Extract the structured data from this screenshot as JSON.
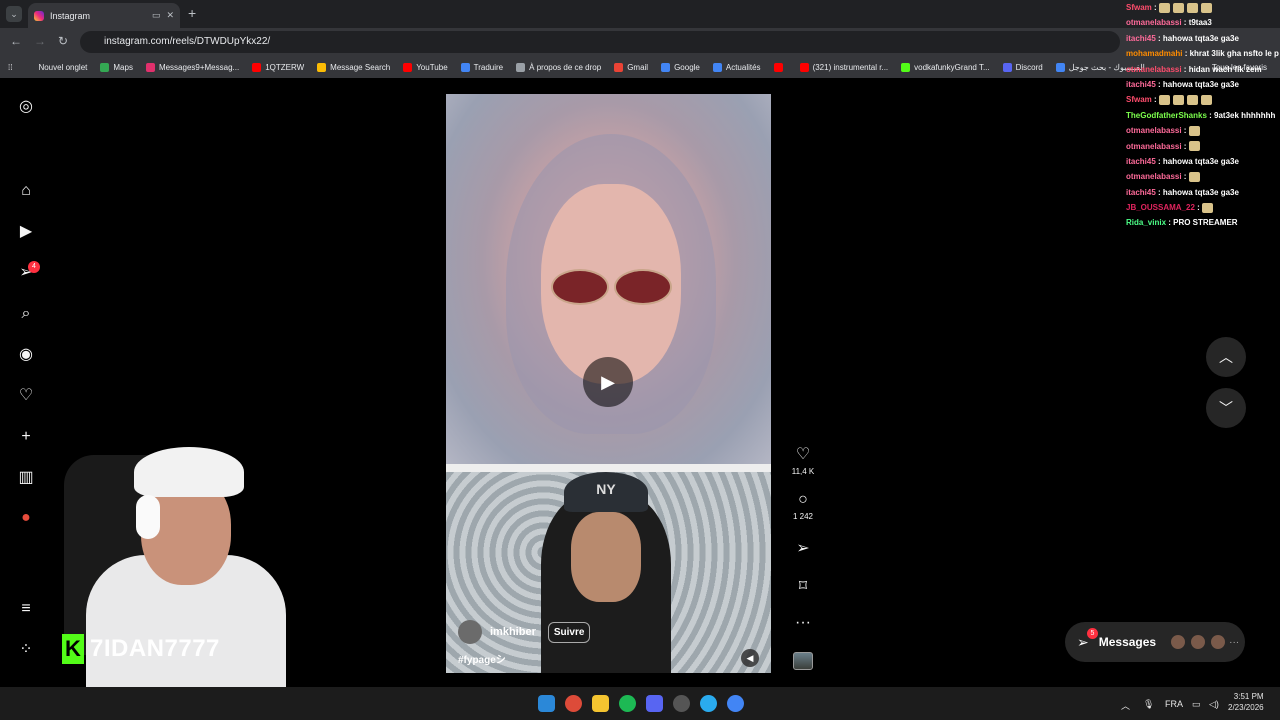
{
  "browser": {
    "tab_title": "Instagram",
    "url": "instagram.com/reels/DTWDUpYkx22/",
    "bookmarks": [
      {
        "label": "Nouvel onglet",
        "color": "#35363a"
      },
      {
        "label": "Maps",
        "color": "#34a853"
      },
      {
        "label": "Messages9+Messag...",
        "color": "#e1306c"
      },
      {
        "label": "1QTZERW",
        "color": "#ff0000"
      },
      {
        "label": "Message Search",
        "color": "#fbbc05"
      },
      {
        "label": "YouTube",
        "color": "#ff0000"
      },
      {
        "label": "Traduire",
        "color": "#4285f4"
      },
      {
        "label": "À propos de ce drop",
        "color": "#9aa0a6"
      },
      {
        "label": "Gmail",
        "color": "#ea4335"
      },
      {
        "label": "Google",
        "color": "#4285f4"
      },
      {
        "label": "Actualités",
        "color": "#4285f4"
      },
      {
        "label": "",
        "color": "#ff0000"
      },
      {
        "label": "(321) instrumental r...",
        "color": "#ff0000"
      },
      {
        "label": "vodkafunkyGrand T...",
        "color": "#53fc18"
      },
      {
        "label": "Discord",
        "color": "#5865f2"
      },
      {
        "label": "الفيسبوك - بحث جوجل",
        "color": "#4285f4"
      }
    ],
    "all_bookmarks": "Tous les favoris"
  },
  "sidebar": {
    "notification_count": "4"
  },
  "reel": {
    "cap_logo": "NY",
    "username": "imkhiber",
    "follow_label": "Suivre",
    "hashtag": "#fypageシ",
    "likes": "11,4 K",
    "comments": "1 242"
  },
  "messages": {
    "label": "Messages",
    "badge": "5"
  },
  "chat": [
    {
      "user": "Sfwam",
      "color": "#ff4d6d",
      "text": "",
      "emotes": 4
    },
    {
      "user": "otmanelabassi",
      "color": "#ff6b9a",
      "text": "t9taa3",
      "emotes": 0
    },
    {
      "user": "itachi45",
      "color": "#ff6b9a",
      "text": "hahowa tqta3e ga3e",
      "emotes": 0
    },
    {
      "user": "mohamadmahi",
      "color": "#ff8c00",
      "text": "khrat 3lik gha nsfto le p",
      "emotes": 0
    },
    {
      "user": "otmanelabassi",
      "color": "#ff4d6d",
      "text": "hidan wach fik zem",
      "emotes": 0
    },
    {
      "user": "itachi45",
      "color": "#ff6b9a",
      "text": "hahowa tqta3e ga3e",
      "emotes": 0
    },
    {
      "user": "Sfwam",
      "color": "#ff4d6d",
      "text": "",
      "emotes": 4
    },
    {
      "user": "TheGodfatherShanks",
      "color": "#7cff4d",
      "text": "9at3ek hhhhhhh",
      "emotes": 0
    },
    {
      "user": "otmanelabassi",
      "color": "#ff6b9a",
      "text": "",
      "emotes": 1
    },
    {
      "user": "otmanelabassi",
      "color": "#ff6b9a",
      "text": "",
      "emotes": 1
    },
    {
      "user": "itachi45",
      "color": "#ff6b9a",
      "text": "hahowa tqta3e ga3e",
      "emotes": 0
    },
    {
      "user": "otmanelabassi",
      "color": "#ff6b9a",
      "text": "",
      "emotes": 1
    },
    {
      "user": "itachi45",
      "color": "#ff6b9a",
      "text": "hahowa tqta3e ga3e",
      "emotes": 0
    },
    {
      "user": "JB_OUSSAMA_22",
      "color": "#e0245e",
      "text": "",
      "emotes": 1
    },
    {
      "user": "Rida_vinix",
      "color": "#4dff88",
      "text": "PRO STREAMER",
      "emotes": 0
    }
  ],
  "streamer": {
    "kick_logo": "K",
    "name": "7IDAN7777"
  },
  "taskbar": {
    "lang": "FRA",
    "time": "3:51 PM",
    "date": "2/23/2026"
  }
}
